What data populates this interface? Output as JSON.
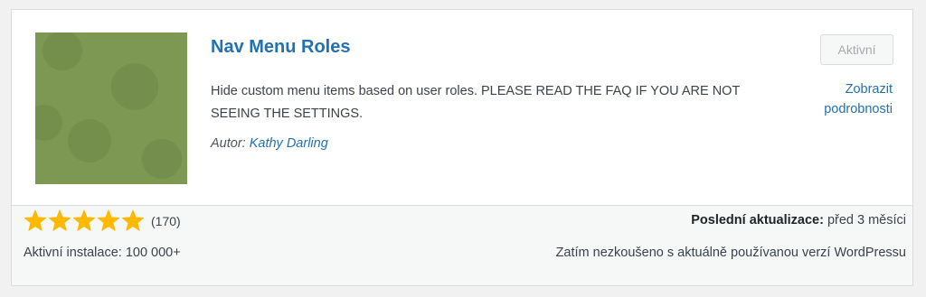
{
  "plugin": {
    "name": "Nav Menu Roles",
    "description": "Hide custom menu items based on user roles. PLEASE READ THE FAQ IF YOU ARE NOT SEEING THE SETTINGS.",
    "author_label": "Autor:",
    "author_name": "Kathy Darling",
    "status_button": "Aktivní",
    "details_link": "Zobrazit podrobnosti",
    "icon_colors": [
      "#6f8b47",
      "#8aa45a",
      "#a4bc72"
    ]
  },
  "footer": {
    "rating_stars": 5,
    "rating_max": 5,
    "rating_count": "(170)",
    "star_color": "#ffb900",
    "active_installs": "Aktivní instalace: 100 000+",
    "last_updated_label": "Poslední aktualizace:",
    "last_updated_value": "před 3 měsíci",
    "compatibility": "Zatím nezkoušeno s aktuálně používanou verzí WordPressu"
  }
}
